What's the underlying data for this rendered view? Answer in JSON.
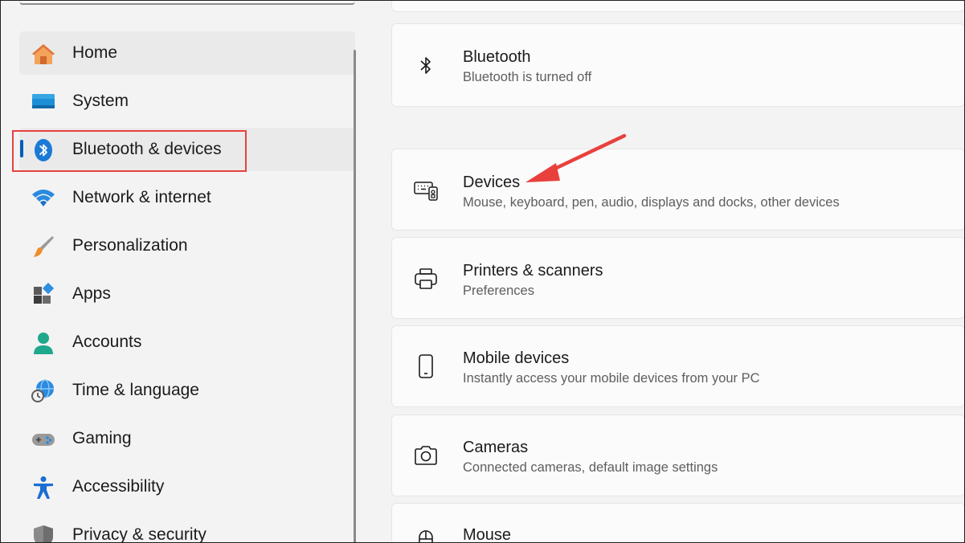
{
  "sidebar": {
    "items": [
      {
        "label": "Home",
        "icon": "home-icon"
      },
      {
        "label": "System",
        "icon": "system-icon"
      },
      {
        "label": "Bluetooth & devices",
        "icon": "bluetooth-icon"
      },
      {
        "label": "Network & internet",
        "icon": "wifi-icon"
      },
      {
        "label": "Personalization",
        "icon": "brush-icon"
      },
      {
        "label": "Apps",
        "icon": "apps-icon"
      },
      {
        "label": "Accounts",
        "icon": "person-icon"
      },
      {
        "label": "Time & language",
        "icon": "globe-clock-icon"
      },
      {
        "label": "Gaming",
        "icon": "gamepad-icon"
      },
      {
        "label": "Accessibility",
        "icon": "accessibility-icon"
      },
      {
        "label": "Privacy & security",
        "icon": "shield-icon"
      }
    ],
    "selected": "Bluetooth & devices"
  },
  "content": {
    "bluetooth": {
      "title": "Bluetooth",
      "subtitle": "Bluetooth is turned off",
      "icon": "bluetooth-icon"
    },
    "cards": [
      {
        "title": "Devices",
        "subtitle": "Mouse, keyboard, pen, audio, displays and docks, other devices",
        "icon": "devices-icon"
      },
      {
        "title": "Printers & scanners",
        "subtitle": "Preferences",
        "icon": "printer-icon"
      },
      {
        "title": "Mobile devices",
        "subtitle": "Instantly access your mobile devices from your PC",
        "icon": "phone-icon"
      },
      {
        "title": "Cameras",
        "subtitle": "Connected cameras, default image settings",
        "icon": "camera-icon"
      },
      {
        "title": "Mouse",
        "subtitle": "",
        "icon": "mouse-icon"
      }
    ]
  },
  "colors": {
    "accent": "#005fb8",
    "annotation": "#e8413d"
  }
}
